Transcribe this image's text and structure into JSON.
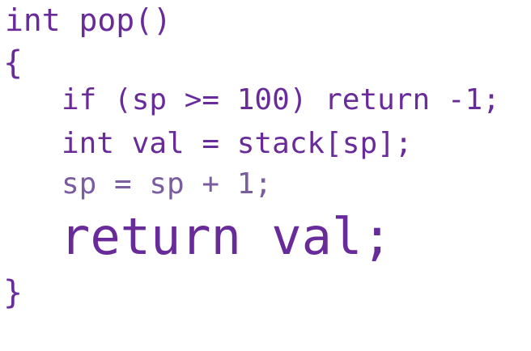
{
  "code": {
    "lines": [
      "int pop()",
      "{",
      "if (sp >= 100) return -1;",
      "int val = stack[sp];",
      "sp = sp + 1;",
      "return val;",
      "}"
    ]
  },
  "colors": {
    "code_text": "#6a2b9a",
    "faded_line_text": "#7a5c9f",
    "background": "#ffffff"
  }
}
